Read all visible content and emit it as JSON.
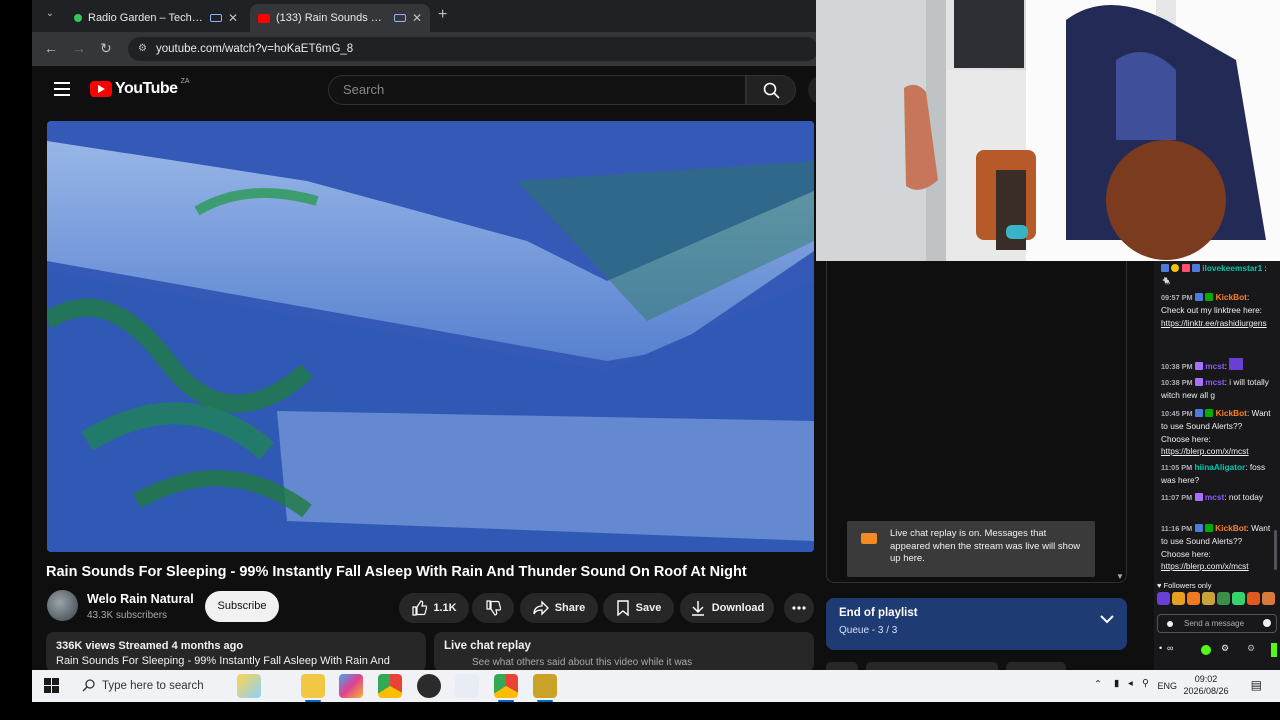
{
  "browser": {
    "tabs": [
      {
        "title": "Radio Garden – Techno Und",
        "active": false
      },
      {
        "title": "(133) Rain Sounds For Slee",
        "active": true
      }
    ],
    "url": "youtube.com/watch?v=hoKaET6mG_8"
  },
  "youtube": {
    "logo_text": "YouTube",
    "country_code": "ZA",
    "search_placeholder": "Search",
    "video_title": "Rain Sounds For Sleeping - 99% Instantly Fall Asleep With Rain And Thunder Sound On Roof At Night",
    "channel_name": "Welo Rain Natural",
    "subscribers": "43.3K subscribers",
    "subscribe_label": "Subscribe",
    "like_count": "1.1K",
    "share_label": "Share",
    "save_label": "Save",
    "download_label": "Download",
    "description_meta": "336K views  Streamed 4 months ago",
    "description_snippet": "Rain Sounds For Sleeping - 99% Instantly Fall Asleep With Rain And",
    "chat_replay_title": "Live chat replay",
    "chat_replay_sub": "See what others said about this video while it was",
    "replay_notice": "Live chat replay is on. Messages that appeared when the stream was live will show up here.",
    "playlist_title": "End of playlist",
    "playlist_queue": "Queue - 3 / 3"
  },
  "twitch_chat": {
    "messages": [
      {
        "time": "",
        "user": "ilovekeemstar1",
        "user_color": "#00c8af",
        "text": ": 🐁"
      },
      {
        "time": "09:57 PM",
        "user": "KickBot",
        "user_color": "#ff7f24",
        "text": ": Check out my linktree here: ",
        "link": "https://linktr.ee/rashidiurgens"
      },
      {
        "time": "10:38 PM",
        "user": "mcst",
        "user_color": "#8a5cf6",
        "text": ":"
      },
      {
        "time": "10:38 PM",
        "user": "mcst",
        "user_color": "#8a5cf6",
        "text": ": i will totally witch new all g"
      },
      {
        "time": "10:45 PM",
        "user": "KickBot",
        "user_color": "#ff7f24",
        "text": ": Want to use Sound Alerts?? Choose here: ",
        "link": "https://blerp.com/x/mcst"
      },
      {
        "time": "11:05 PM",
        "user": "hiinaAligator",
        "user_color": "#00c8af",
        "text": ": foss was here?"
      },
      {
        "time": "11:07 PM",
        "user": "mcst",
        "user_color": "#8a5cf6",
        "text": ": not today"
      },
      {
        "time": "11:16 PM",
        "user": "KickBot",
        "user_color": "#ff7f24",
        "text": ": Want to use Sound Alerts?? Choose here: ",
        "link": "https://blerp.com/x/mcst"
      }
    ],
    "followers_only": "♥ Followers only",
    "send_placeholder": "Send a message",
    "tools_text": "∞"
  },
  "taskbar": {
    "search_placeholder": "Type here to search",
    "lang": "ENG",
    "time": "09:02",
    "date": "2026/08/26"
  },
  "colors": {
    "youtube_red": "#ff0000",
    "kickbot": "#ff7f24",
    "playlist_bg": "#1f3b74",
    "twitch_bg": "#18181b"
  }
}
